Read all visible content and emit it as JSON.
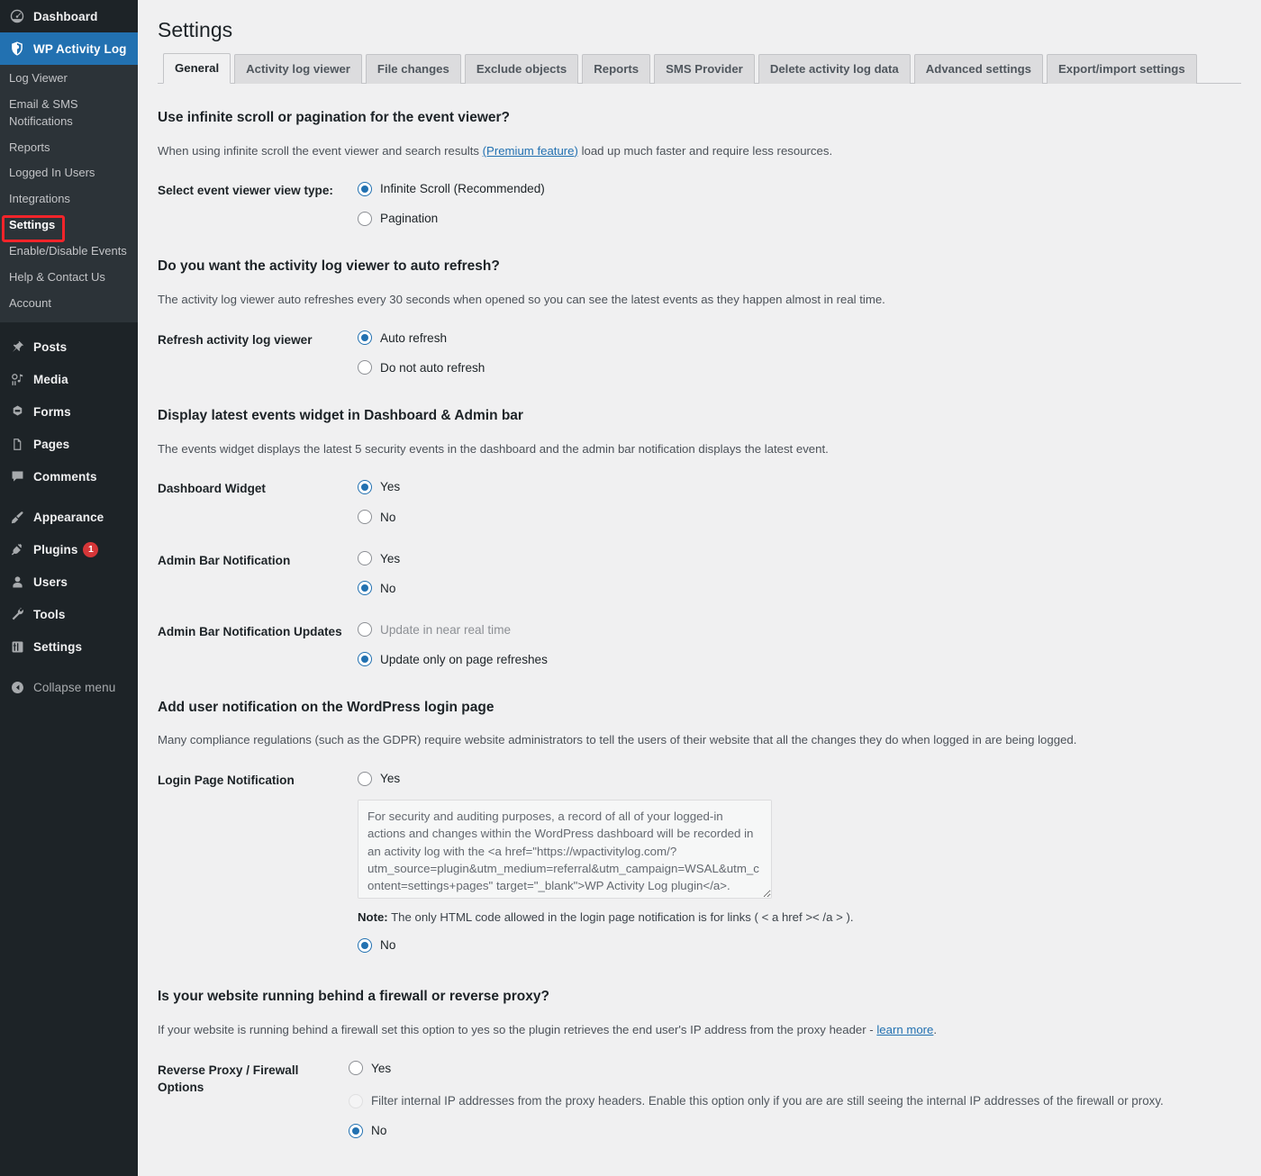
{
  "colors": {
    "accent": "#2271b1",
    "sidebar_bg": "#1d2327",
    "submenu_bg": "#2c3338",
    "content_bg": "#f0f0f1",
    "highlight_box": "#f3242a",
    "badge": "#d63638"
  },
  "sidebar": {
    "top_items": [
      {
        "label": "Dashboard",
        "icon": "dashboard-icon",
        "current": false
      },
      {
        "label": "WP Activity Log",
        "icon": "shield-icon",
        "current": true
      }
    ],
    "submenu": [
      {
        "label": "Log Viewer",
        "current": false
      },
      {
        "label": "Email & SMS Notifications",
        "current": false
      },
      {
        "label": "Reports",
        "current": false
      },
      {
        "label": "Logged In Users",
        "current": false
      },
      {
        "label": "Integrations",
        "current": false
      },
      {
        "label": "Settings",
        "current": true,
        "highlighted": true
      },
      {
        "label": "Enable/Disable Events",
        "current": false
      },
      {
        "label": "Help & Contact Us",
        "current": false
      },
      {
        "label": "Account",
        "current": false
      }
    ],
    "group_two": [
      {
        "label": "Posts",
        "icon": "pin-icon"
      },
      {
        "label": "Media",
        "icon": "media-icon"
      },
      {
        "label": "Forms",
        "icon": "forms-icon"
      },
      {
        "label": "Pages",
        "icon": "pages-icon"
      },
      {
        "label": "Comments",
        "icon": "comments-icon"
      }
    ],
    "group_three": [
      {
        "label": "Appearance",
        "icon": "appearance-brush-icon",
        "badge": ""
      },
      {
        "label": "Plugins",
        "icon": "plugins-plug-icon",
        "badge": "1"
      },
      {
        "label": "Users",
        "icon": "users-icon",
        "badge": ""
      },
      {
        "label": "Tools",
        "icon": "tools-wrench-icon",
        "badge": ""
      },
      {
        "label": "Settings",
        "icon": "settings-sliders-icon",
        "badge": ""
      }
    ],
    "collapse": {
      "label": "Collapse menu",
      "icon": "collapse-arrow-icon"
    }
  },
  "header": {
    "title": "Settings"
  },
  "tabs": [
    {
      "label": "General",
      "active": true
    },
    {
      "label": "Activity log viewer",
      "active": false
    },
    {
      "label": "File changes",
      "active": false
    },
    {
      "label": "Exclude objects",
      "active": false
    },
    {
      "label": "Reports",
      "active": false
    },
    {
      "label": "SMS Provider",
      "active": false
    },
    {
      "label": "Delete activity log data",
      "active": false
    },
    {
      "label": "Advanced settings",
      "active": false
    },
    {
      "label": "Export/import settings",
      "active": false
    }
  ],
  "sections": {
    "scroll": {
      "heading": "Use infinite scroll or pagination for the event viewer?",
      "desc_before": "When using infinite scroll the event viewer and search results ",
      "desc_link": "(Premium feature)",
      "desc_after": " load up much faster and require less resources.",
      "row_label": "Select event viewer view type:",
      "options": [
        {
          "label": "Infinite Scroll (Recommended)",
          "checked": true
        },
        {
          "label": "Pagination",
          "checked": false
        }
      ]
    },
    "refresh": {
      "heading": "Do you want the activity log viewer to auto refresh?",
      "desc": "The activity log viewer auto refreshes every 30 seconds when opened so you can see the latest events as they happen almost in real time.",
      "row_label": "Refresh activity log viewer",
      "options": [
        {
          "label": "Auto refresh",
          "checked": true
        },
        {
          "label": "Do not auto refresh",
          "checked": false
        }
      ]
    },
    "widget": {
      "heading": "Display latest events widget in Dashboard & Admin bar",
      "desc": "The events widget displays the latest 5 security events in the dashboard and the admin bar notification displays the latest event.",
      "rows": [
        {
          "label": "Dashboard Widget",
          "options": [
            {
              "label": "Yes",
              "checked": true
            },
            {
              "label": "No",
              "checked": false
            }
          ]
        },
        {
          "label": "Admin Bar Notification",
          "options": [
            {
              "label": "Yes",
              "checked": false
            },
            {
              "label": "No",
              "checked": true
            }
          ]
        },
        {
          "label": "Admin Bar Notification Updates",
          "options": [
            {
              "label": "Update in near real time",
              "checked": false,
              "disabled": true
            },
            {
              "label": "Update only on page refreshes",
              "checked": true
            }
          ]
        }
      ]
    },
    "login_notification": {
      "heading": "Add user notification on the WordPress login page",
      "desc": "Many compliance regulations (such as the GDPR) require website administrators to tell the users of their website that all the changes they do when logged in are being logged.",
      "row_label": "Login Page Notification",
      "yes_label": "Yes",
      "yes_checked": false,
      "textarea_value": "For security and auditing purposes, a record of all of your logged-in actions and changes within the WordPress dashboard will be recorded in an activity log with the <a href=\"https://wpactivitylog.com/?utm_source=plugin&utm_medium=referral&utm_campaign=WSAL&utm_content=settings+pages\" target=\"_blank\">WP Activity Log plugin</a>.",
      "note_bold": "Note:",
      "note_text": " The only HTML code allowed in the login page notification is for links ( < a href >< /a > ).",
      "no_label": "No",
      "no_checked": true
    },
    "proxy": {
      "heading": "Is your website running behind a firewall or reverse proxy?",
      "desc_before": "If your website is running behind a firewall set this option to yes so the plugin retrieves the end user's IP address from the proxy header - ",
      "desc_link": "learn more",
      "desc_after": ".",
      "row_label": "Reverse Proxy / Firewall Options",
      "yes_label": "Yes",
      "yes_checked": false,
      "filter_label": "Filter internal IP addresses from the proxy headers. Enable this option only if you are are still seeing the internal IP addresses of the firewall or proxy.",
      "filter_checked": false,
      "no_label": "No",
      "no_checked": true
    }
  }
}
